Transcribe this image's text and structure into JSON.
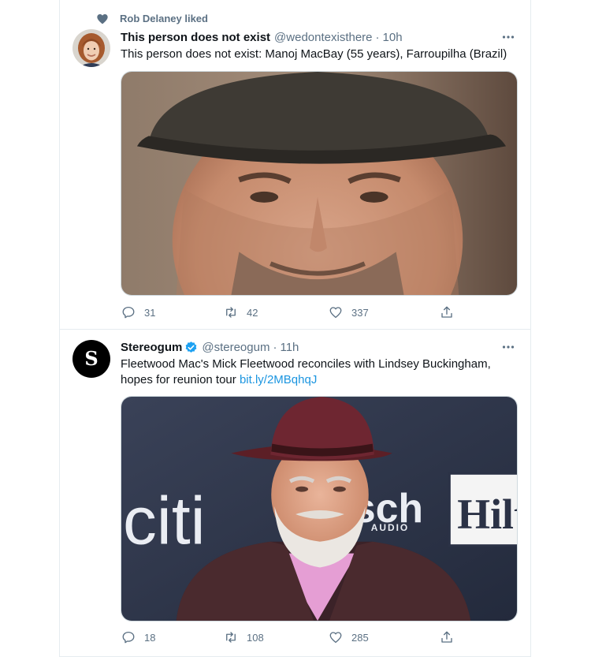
{
  "tweets": [
    {
      "social_context": "Rob Delaney liked",
      "author_name": "This person does not exist",
      "handle": "@wedontexisthere",
      "separator": "·",
      "time": "10h",
      "text": "This person does not exist: Manoj MacBay (55 years), Farroupilha (Brazil)",
      "stats": {
        "replies": "31",
        "retweets": "42",
        "likes": "337"
      }
    },
    {
      "author_name": "Stereogum",
      "verified": true,
      "handle": "@stereogum",
      "separator": "·",
      "time": "11h",
      "avatar_letter": "S",
      "text": "Fleetwood Mac's Mick Fleetwood reconciles with Lindsey Buckingham, hopes for reunion tour ",
      "link": "bit.ly/2MBqhqJ",
      "stats": {
        "replies": "18",
        "retweets": "108",
        "likes": "285"
      },
      "media_brand_text": {
        "left": "citi",
        "middle": "sch",
        "middle_sub": "AUDIO",
        "right": "Hilt"
      }
    }
  ],
  "colors": {
    "accent": "#1da1f2",
    "link": "#1b95e0",
    "secondary_text": "#5b7083",
    "divider": "#e6ecf0"
  },
  "icons": [
    "heart-icon",
    "more-icon",
    "verified-icon",
    "reply-icon",
    "retweet-icon",
    "like-icon",
    "share-icon"
  ]
}
